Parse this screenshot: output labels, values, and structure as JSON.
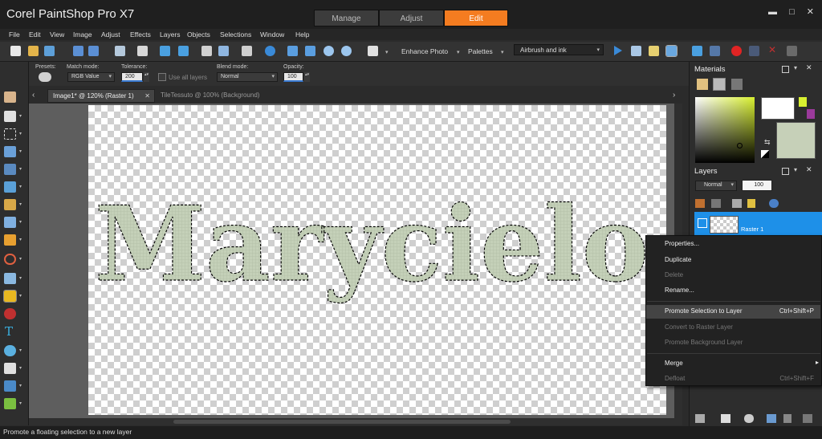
{
  "app": {
    "title": "Corel PaintShop Pro X7",
    "workspace_tabs": [
      "Manage",
      "Adjust",
      "Edit"
    ],
    "active_workspace": "Edit",
    "window_controls": [
      "▬",
      "□",
      "✕"
    ]
  },
  "colors": {
    "accent": "#f47c20",
    "selection_blue": "#1e90e8",
    "text_fill": "#c4d0b8",
    "foreground_swatch": "#d8f030",
    "background_swatch": "#9b3a9b"
  },
  "menubar": [
    "File",
    "Edit",
    "View",
    "Image",
    "Adjust",
    "Effects",
    "Layers",
    "Objects",
    "Selections",
    "Window",
    "Help"
  ],
  "toolbar": {
    "enhance_photo": "Enhance Photo",
    "palettes": "Palettes",
    "brush_preset": "Airbrush and ink",
    "icons": [
      "new-icon",
      "open-icon",
      "scan-icon",
      "save-icon",
      "save-as-icon",
      "share-icon",
      "print-icon",
      "undo-icon",
      "redo-icon",
      "resize-icon",
      "crop-icon",
      "info-icon",
      "fit-icon",
      "actual-size-icon",
      "zoom-out-icon",
      "zoom-in-icon",
      "arrange-icon"
    ]
  },
  "tool_options": {
    "presets_label": "Presets:",
    "match_mode_label": "Match mode:",
    "match_mode_value": "RGB Value",
    "tolerance_label": "Tolerance:",
    "tolerance_value": "200",
    "use_all_layers": "Use all layers",
    "blend_mode_label": "Blend mode:",
    "blend_mode_value": "Normal",
    "opacity_label": "Opacity:",
    "opacity_value": "100"
  },
  "documents": {
    "active": "Image1* @ 120% (Raster 1)",
    "inactive": "TileTessuto @ 100% (Background)"
  },
  "canvas": {
    "text": "Marycielo"
  },
  "panels": {
    "materials": "Materials",
    "layers": "Layers",
    "layers_blend": "Normal",
    "layers_opacity": "100",
    "layer_name": "Raster 1"
  },
  "context_menu": {
    "items": [
      {
        "label": "Properties...",
        "shortcut": "",
        "disabled": false
      },
      {
        "label": "Duplicate",
        "shortcut": "",
        "disabled": false
      },
      {
        "label": "Delete",
        "shortcut": "",
        "disabled": true
      },
      {
        "label": "Rename...",
        "shortcut": "",
        "disabled": false
      },
      {
        "label": "Promote Selection to Layer",
        "shortcut": "Ctrl+Shift+P",
        "disabled": false
      },
      {
        "label": "Convert to Raster Layer",
        "shortcut": "",
        "disabled": true
      },
      {
        "label": "Promote Background Layer",
        "shortcut": "",
        "disabled": true
      },
      {
        "label": "Merge",
        "shortcut": "▸",
        "disabled": false
      },
      {
        "label": "Defloat",
        "shortcut": "Ctrl+Shift+F",
        "disabled": true
      }
    ]
  },
  "status": {
    "text": "Promote a floating selection to a new layer"
  }
}
